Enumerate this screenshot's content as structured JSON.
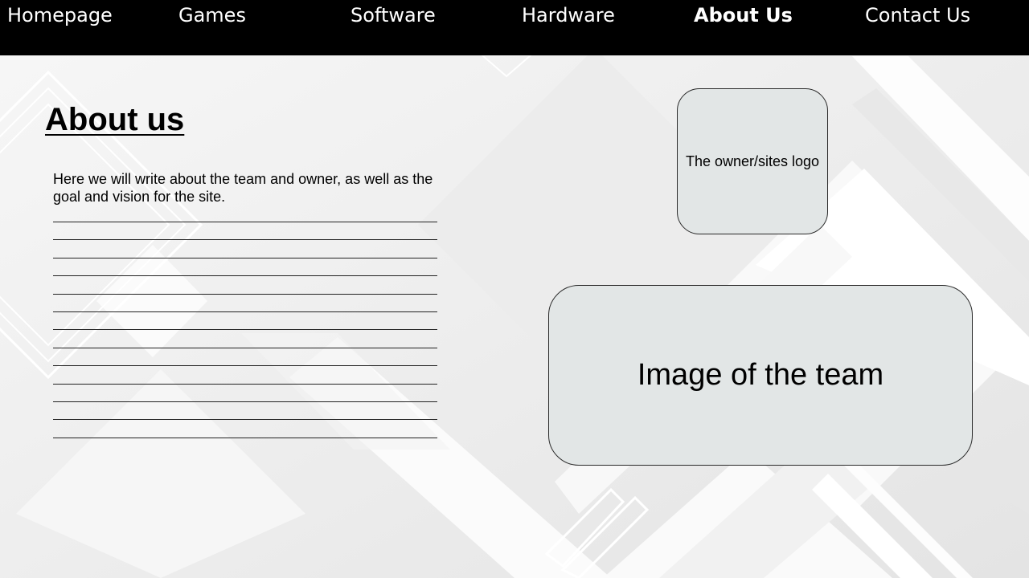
{
  "nav": {
    "items": [
      {
        "label": "Homepage",
        "active": false
      },
      {
        "label": "Games",
        "active": false
      },
      {
        "label": "Software",
        "active": false
      },
      {
        "label": "Hardware",
        "active": false
      },
      {
        "label": "About Us",
        "active": true
      },
      {
        "label": "Contact Us",
        "active": false
      }
    ]
  },
  "main": {
    "title": "About us",
    "intro": "Here we will write about the team and owner, as well as the goal and vision for the site.",
    "writing_line_count": 13
  },
  "logo_placeholder": {
    "label": "The owner/sites logo"
  },
  "team_image_placeholder": {
    "label": "Image of the team"
  },
  "colors": {
    "nav_background": "#000000",
    "nav_text": "#ffffff",
    "placeholder_fill": "#e2e6e6",
    "page_background": "#f2f2f2"
  }
}
